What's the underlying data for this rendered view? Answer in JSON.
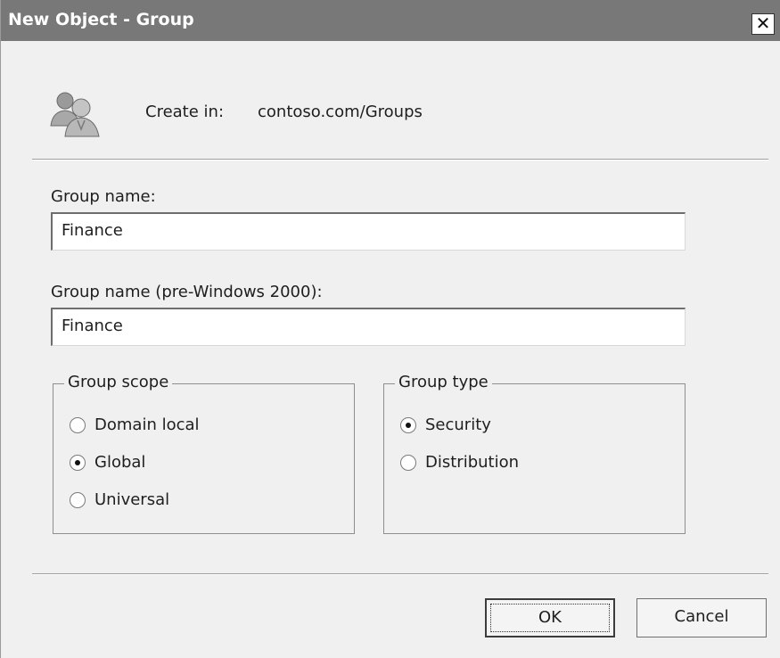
{
  "window": {
    "title": "New Object - Group",
    "close_glyph": "✕"
  },
  "header": {
    "icon": "users-group-icon",
    "create_in_label": "Create in:",
    "create_in_value": "contoso.com/Groups"
  },
  "group_name": {
    "label": "Group name:",
    "value": "Finance"
  },
  "group_name_pre2000": {
    "label": "Group name (pre-Windows 2000):",
    "value": "Finance"
  },
  "group_scope": {
    "legend": "Group scope",
    "options": [
      {
        "label": "Domain local",
        "checked": false
      },
      {
        "label": "Global",
        "checked": true
      },
      {
        "label": "Universal",
        "checked": false
      }
    ]
  },
  "group_type": {
    "legend": "Group type",
    "options": [
      {
        "label": "Security",
        "checked": true
      },
      {
        "label": "Distribution",
        "checked": false
      }
    ]
  },
  "buttons": {
    "ok": "OK",
    "cancel": "Cancel"
  },
  "colors": {
    "titlebar": "#787878",
    "dialog_bg": "#f0f0f0",
    "text": "#1e1e1e"
  }
}
